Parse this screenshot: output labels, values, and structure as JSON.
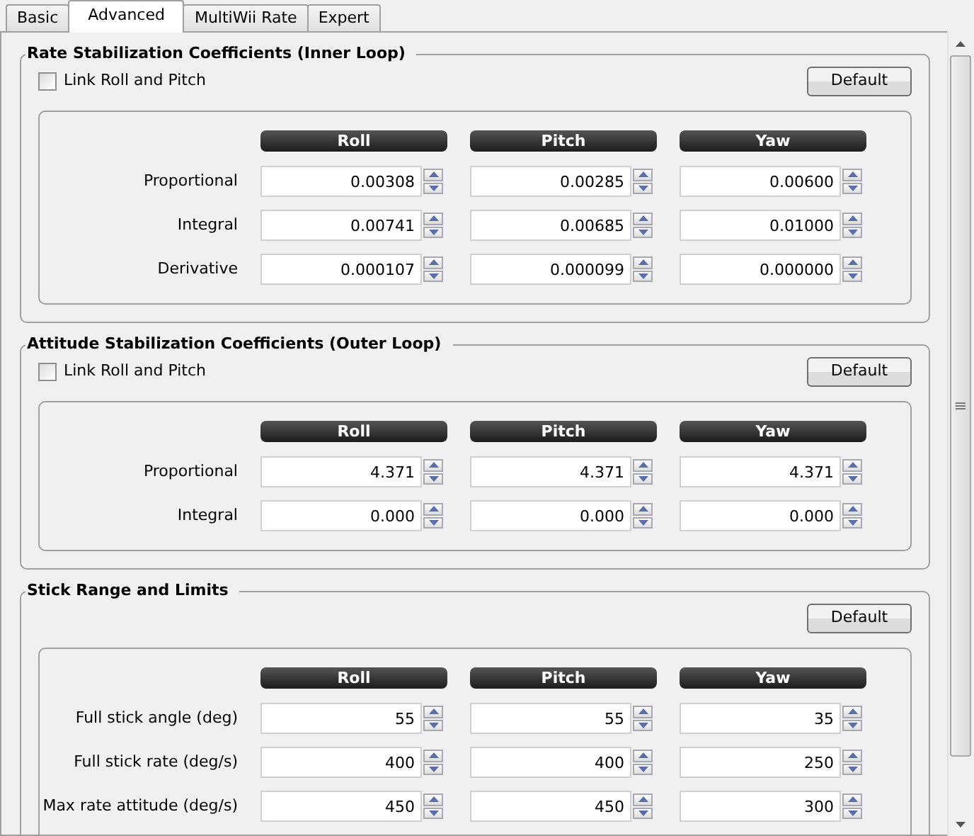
{
  "tabs": [
    {
      "label": "Basic",
      "selected": false
    },
    {
      "label": "Advanced",
      "selected": true
    },
    {
      "label": "MultiWii Rate",
      "selected": false
    },
    {
      "label": "Expert",
      "selected": false
    }
  ],
  "groups": [
    {
      "title": "Rate Stabilization Coefficients (Inner Loop)",
      "link": {
        "label": "Link Roll and Pitch",
        "checked": false
      },
      "default_button": "Default",
      "columns": [
        "Roll",
        "Pitch",
        "Yaw"
      ],
      "rows": [
        {
          "label": "Proportional",
          "values": [
            "0.00308",
            "0.00285",
            "0.00600"
          ]
        },
        {
          "label": "Integral",
          "values": [
            "0.00741",
            "0.00685",
            "0.01000"
          ]
        },
        {
          "label": "Derivative",
          "values": [
            "0.000107",
            "0.000099",
            "0.000000"
          ]
        }
      ]
    },
    {
      "title": "Attitude Stabilization Coefficients (Outer Loop)",
      "link": {
        "label": "Link Roll and Pitch",
        "checked": false
      },
      "default_button": "Default",
      "columns": [
        "Roll",
        "Pitch",
        "Yaw"
      ],
      "rows": [
        {
          "label": "Proportional",
          "values": [
            "4.371",
            "4.371",
            "4.371"
          ]
        },
        {
          "label": "Integral",
          "values": [
            "0.000",
            "0.000",
            "0.000"
          ]
        }
      ]
    },
    {
      "title": "Stick Range and Limits",
      "default_button": "Default",
      "columns": [
        "Roll",
        "Pitch",
        "Yaw"
      ],
      "rows": [
        {
          "label": "Full stick angle (deg)",
          "values": [
            "55",
            "55",
            "35"
          ]
        },
        {
          "label": "Full stick rate (deg/s)",
          "values": [
            "400",
            "400",
            "250"
          ]
        },
        {
          "label": "Max rate attitude (deg/s)",
          "values": [
            "450",
            "450",
            "300"
          ]
        }
      ]
    }
  ]
}
